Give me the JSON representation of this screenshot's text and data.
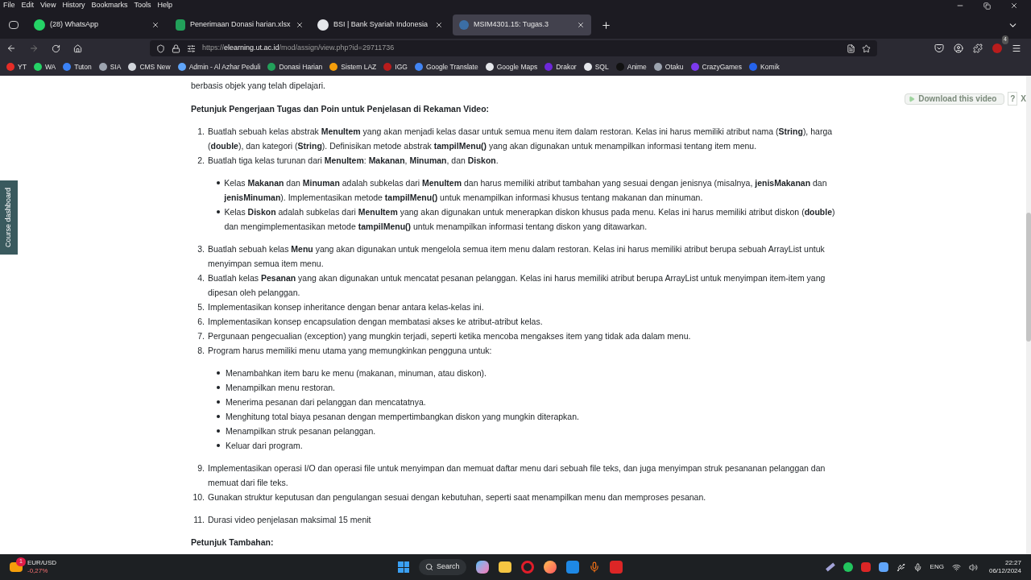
{
  "menu_bar": [
    "File",
    "Edit",
    "View",
    "History",
    "Bookmarks",
    "Tools",
    "Help"
  ],
  "tabs": [
    {
      "title": "(28) WhatsApp",
      "selected": false
    },
    {
      "title": "Penerimaan Donasi harian.xlsx",
      "selected": false
    },
    {
      "title": "BSI | Bank Syariah Indonesia",
      "selected": false
    },
    {
      "title": "MSIM4301.15: Tugas.3",
      "selected": true
    }
  ],
  "address_bar": {
    "url": "https://**elearning.ut.ac.id**/mod/assign/view.php?id=29711736"
  },
  "extension_badge": "4",
  "bookmarks": [
    {
      "label": "YT",
      "color": "#e52d27"
    },
    {
      "label": "WA",
      "color": "#25d366"
    },
    {
      "label": "Tuton",
      "color": "#3b82f6"
    },
    {
      "label": "SIA",
      "color": "#9ca3af"
    },
    {
      "label": "CMS New",
      "color": "#d1d5db"
    },
    {
      "label": "Admin - Al Azhar Peduli",
      "color": "#60a5fa"
    },
    {
      "label": "Donasi Harian",
      "color": "#22a05a"
    },
    {
      "label": "Sistem LAZ",
      "color": "#f59e0b"
    },
    {
      "label": "IGG",
      "color": "#b91c1c"
    },
    {
      "label": "Google Translate",
      "color": "#4285f4"
    },
    {
      "label": "Google Maps",
      "color": "#e5e7eb"
    },
    {
      "label": "Drakor",
      "color": "#6d28d9"
    },
    {
      "label": "SQL",
      "color": "#e5e7eb"
    },
    {
      "label": "Anime",
      "color": "#111111"
    },
    {
      "label": "Otaku",
      "color": "#9ca3af"
    },
    {
      "label": "CrazyGames",
      "color": "#7c3aed"
    },
    {
      "label": "Komik",
      "color": "#2563eb"
    }
  ],
  "page": {
    "intro": "berbasis objek yang telah dipelajari.",
    "heading": "Petunjuk Pengerjaan Tugas dan Poin untuk Penjelasan di Rekaman Video:",
    "items": [
      {
        "number": "1.",
        "text": "Buatlah sebuah kelas abstrak **MenuItem** yang akan menjadi kelas dasar untuk semua menu item dalam restoran. Kelas ini harus memiliki atribut nama (**String**), harga (**double**), dan kategori (**String**). Definisikan metode abstrak **tampilMenu()** yang akan digunakan untuk menampilkan informasi tentang item menu."
      },
      {
        "number": "2.",
        "text": "Buatlah tiga kelas turunan dari **MenuItem**: **Makanan**, **Minuman**, dan **Diskon**.",
        "children": [
          "Kelas **Makanan** dan **Minuman** adalah subkelas dari **MenuItem** dan harus memiliki atribut tambahan yang sesuai dengan jenisnya (misalnya, **jenisMakanan** dan **jenisMinuman**). Implementasikan metode **tampilMenu()** untuk menampilkan informasi khusus tentang makanan dan minuman.",
          "Kelas **Diskon** adalah subkelas dari **MenuItem** yang akan digunakan untuk menerapkan diskon khusus pada menu. Kelas ini harus memiliki atribut diskon (**double**) dan mengimplementasikan metode **tampilMenu()** untuk menampilkan informasi tentang diskon yang ditawarkan."
        ]
      },
      {
        "number": "3.",
        "text": "Buatlah sebuah kelas **Menu** yang akan digunakan untuk mengelola semua item menu dalam restoran. Kelas ini harus memiliki atribut berupa sebuah ArrayList untuk menyimpan semua item menu."
      },
      {
        "number": "4.",
        "text": "Buatlah kelas **Pesanan** yang akan digunakan untuk mencatat pesanan pelanggan. Kelas ini harus memiliki atribut berupa ArrayList untuk menyimpan item-item yang dipesan oleh pelanggan."
      },
      {
        "number": "5.",
        "text": "Implementasikan konsep inheritance dengan benar antara kelas-kelas ini."
      },
      {
        "number": "6.",
        "text": "Implementasikan konsep encapsulation dengan membatasi akses ke atribut-atribut kelas."
      },
      {
        "number": "7.",
        "text": "Pergunaan pengecualian (exception) yang mungkin terjadi, seperti ketika mencoba mengakses item yang tidak ada dalam menu."
      },
      {
        "number": "8.",
        "text": "Program harus memiliki menu utama yang memungkinkan pengguna untuk:",
        "children": [
          "Menambahkan item baru ke menu (makanan, minuman, atau diskon).",
          "Menampilkan menu restoran.",
          "Menerima pesanan dari pelanggan dan mencatatnya.",
          "Menghitung total biaya pesanan dengan mempertimbangkan diskon yang mungkin diterapkan.",
          "Menampilkan struk pesanan pelanggan.",
          "Keluar dari program."
        ]
      },
      {
        "number": "9.",
        "text": "Implementasikan operasi I/O dan operasi file untuk menyimpan dan memuat daftar menu dari sebuah file teks, dan juga menyimpan struk pesananan pelanggan dan memuat dari file teks."
      },
      {
        "number": "10.",
        "text": "Gunakan struktur keputusan dan pengulangan sesuai dengan kebutuhan, seperti saat menampilkan menu dan memproses pesanan."
      }
    ],
    "second_list": [
      {
        "number": "11.",
        "text": "Durasi video penjelasan maksimal 15 menit"
      }
    ],
    "next_heading": "Petunjuk Tambahan:"
  },
  "side_tab": "Course dashboard",
  "download_overlay": {
    "label": "Download this video",
    "help": "?",
    "close": "X"
  },
  "taskbar": {
    "ticker_badge": "1",
    "ticker_name": "EUR/USD",
    "ticker_change": "-0,27%",
    "search": "Search",
    "language": "ENG",
    "time": "22:27",
    "date": "06/12/2024"
  }
}
